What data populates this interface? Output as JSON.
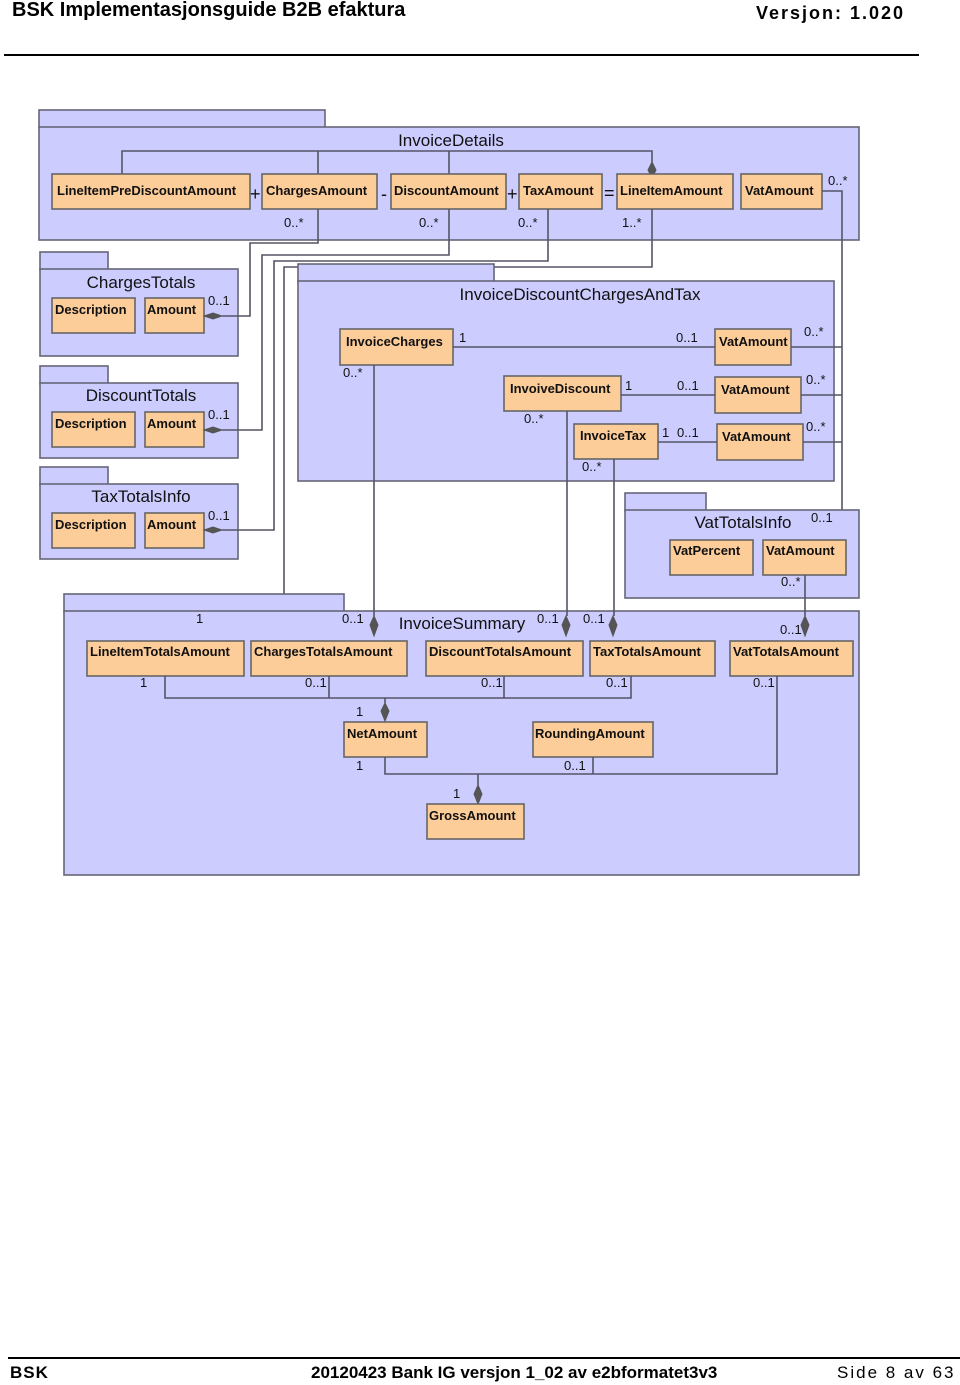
{
  "header": {
    "title": "BSK Implementasjonsguide B2B efaktura",
    "version": "Versjon: 1.020"
  },
  "footer": {
    "left": "BSK",
    "center": "20120423 Bank IG versjon 1_02 av e2bformatet3v3",
    "right": "Side 8 av 63"
  },
  "colors": {
    "package_fill": "#ccccff",
    "class_fill": "#fccc99",
    "line": "#555566"
  },
  "diagram": {
    "packages": {
      "invoice_details": "InvoiceDetails",
      "charges_totals": "ChargesTotals",
      "discount_totals": "DiscountTotals",
      "tax_totals_info": "TaxTotalsInfo",
      "invoice_discount_charges_and_tax": "InvoiceDiscountChargesAndTax",
      "vat_totals_info": "VatTotalsInfo",
      "invoice_summary": "InvoiceSummary"
    },
    "invoice_details": {
      "classes": [
        "LineItemPreDiscountAmount",
        "ChargesAmount",
        "DiscountAmount",
        "TaxAmount",
        "LineItemAmount",
        "VatAmount"
      ],
      "operators": [
        "+",
        "-",
        "+",
        "="
      ],
      "multiplicities": {
        "charges": "0..*",
        "discount": "0..*",
        "tax": "0..*",
        "line_item": "1..*",
        "vat": "0..*"
      }
    },
    "charges_totals": {
      "classes": [
        "Description",
        "Amount"
      ],
      "mult": "0..1"
    },
    "discount_totals": {
      "classes": [
        "Description",
        "Amount"
      ],
      "mult": "0..1"
    },
    "tax_totals_info": {
      "classes": [
        "Description",
        "Amount"
      ],
      "mult": "0..1"
    },
    "idcat": {
      "invoice_charges": "InvoiceCharges",
      "invoive_discount": "InvoiveDiscount",
      "invoice_tax": "InvoiceTax",
      "vat_amount": "VatAmount",
      "mult_one": "1",
      "mult_zero_one": "0..1",
      "mult_zero_many": "0..*"
    },
    "vat_totals_info": {
      "classes": [
        "VatPercent",
        "VatAmount"
      ],
      "mult_top": "0..1",
      "mult_bottom": "0..*"
    },
    "invoice_summary": {
      "classes": [
        "LineItemTotalsAmount",
        "ChargesTotalsAmount",
        "DiscountTotalsAmount",
        "TaxTotalsAmount",
        "VatTotalsAmount",
        "NetAmount",
        "RoundingAmount",
        "GrossAmount"
      ],
      "mult_one": "1",
      "mult_zero_one": "0..1"
    }
  }
}
